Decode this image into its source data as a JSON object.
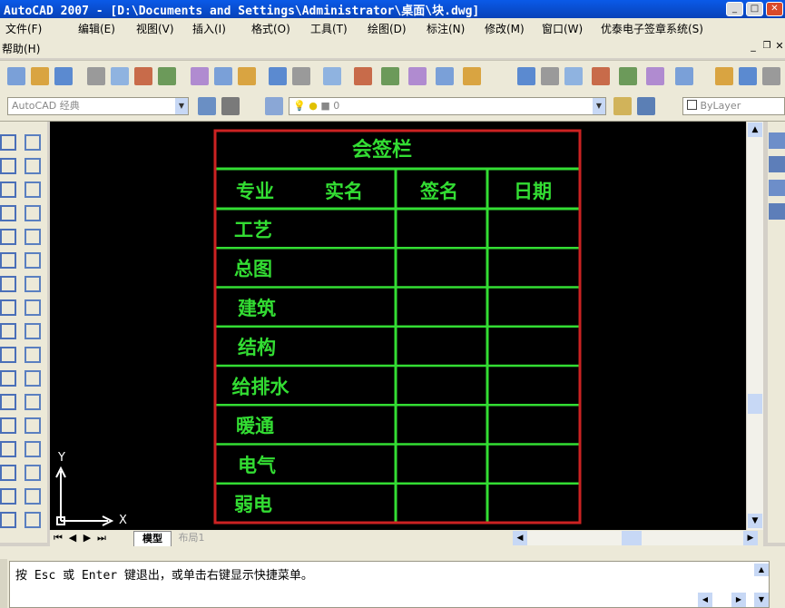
{
  "window": {
    "title": "AutoCAD 2007 - [D:\\Documents and Settings\\Administrator\\桌面\\块.dwg]",
    "controls": [
      "_",
      "□",
      "✕"
    ]
  },
  "menubar": {
    "items": [
      "文件(F)",
      "编辑(E)",
      "视图(V)",
      "插入(I)",
      "格式(O)",
      "工具(T)",
      "绘图(D)",
      "标注(N)",
      "修改(M)",
      "窗口(W)",
      "优泰电子签章系统(S)"
    ],
    "second_row": [
      "帮助(H)"
    ]
  },
  "toolbar2": {
    "workspace_combo": "AutoCAD 经典",
    "layer_combo": "0",
    "color_combo": "ByLayer"
  },
  "signature_table": {
    "title": "会签栏",
    "headers": [
      "专业",
      "实名",
      "签名",
      "日期"
    ],
    "rows": [
      "工艺",
      "总图",
      "建筑",
      "结构",
      "给排水",
      "暖通",
      "电气",
      "弱电"
    ],
    "colors": {
      "lines": "#33dd33",
      "text": "#33dd33",
      "border": "#cc2222"
    }
  },
  "ucs": {
    "x_label": "X",
    "y_label": "Y"
  },
  "tabs": {
    "model": "模型",
    "layout": "布局1"
  },
  "commandline": {
    "text": "按 Esc 或 Enter 键退出，或单击右键显示快捷菜单。"
  }
}
